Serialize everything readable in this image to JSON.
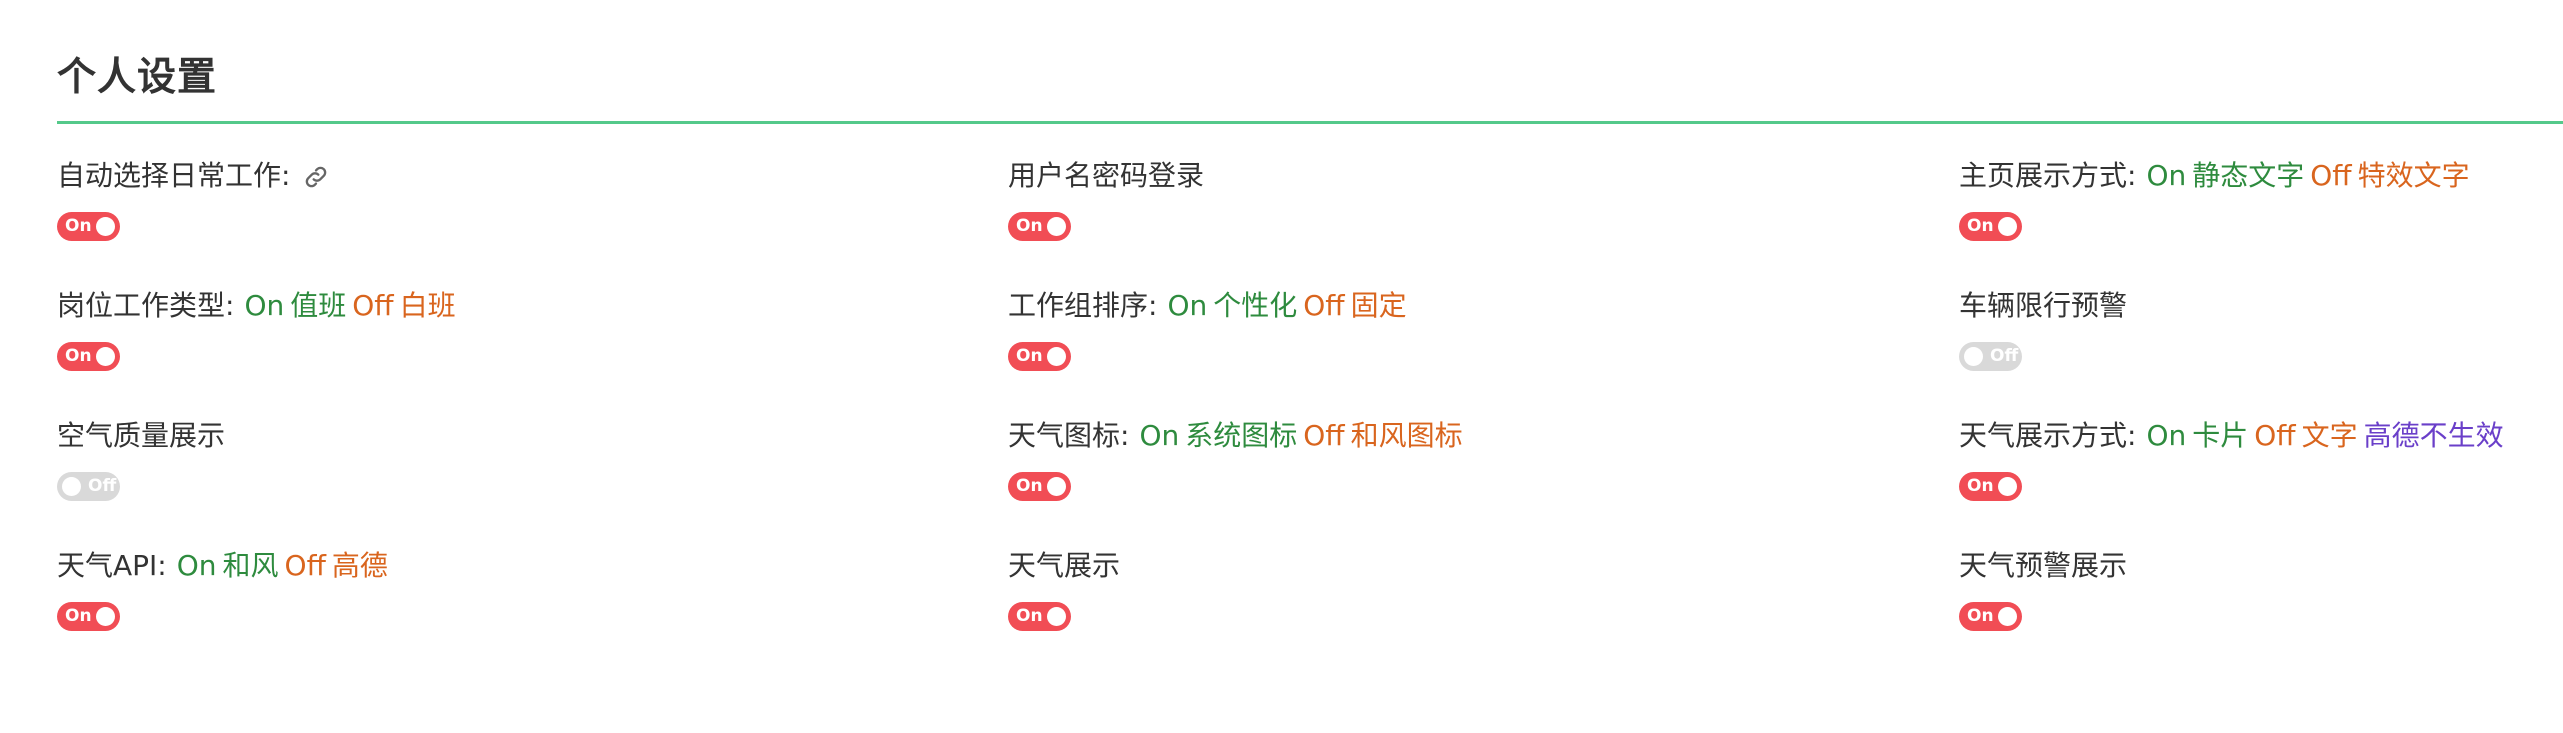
{
  "page_title": "个人设置",
  "colors": {
    "accent_line": "#54c98a",
    "switch_on": "#f14d55",
    "switch_off": "#d9d9d9",
    "on_option": "#2e8b3e",
    "off_option": "#d9651e",
    "extra_option": "#6a3fc9"
  },
  "settings": [
    {
      "name": "自动选择日常工作:",
      "icon": "link-icon",
      "state": "On"
    },
    {
      "name": "用户名密码登录",
      "state": "On"
    },
    {
      "name": "主页展示方式:",
      "on_key": "On",
      "on_label": "静态文字",
      "off_key": "Off",
      "off_label": "特效文字",
      "state": "On"
    },
    {
      "name": "岗位工作类型:",
      "on_key": "On",
      "on_label": "值班",
      "off_key": "Off",
      "off_label": "白班",
      "state": "On"
    },
    {
      "name": "工作组排序:",
      "on_key": "On",
      "on_label": "个性化",
      "off_key": "Off",
      "off_label": "固定",
      "state": "On"
    },
    {
      "name": "车辆限行预警",
      "state": "Off"
    },
    {
      "name": "空气质量展示",
      "state": "Off"
    },
    {
      "name": "天气图标:",
      "on_key": "On",
      "on_label": "系统图标",
      "off_key": "Off",
      "off_label": "和风图标",
      "state": "On"
    },
    {
      "name": "天气展示方式:",
      "on_key": "On",
      "on_label": "卡片",
      "off_key": "Off",
      "off_label": "文字",
      "extra": "高德不生效",
      "state": "On"
    },
    {
      "name": "天气API:",
      "on_key": "On",
      "on_label": "和风",
      "off_key": "Off",
      "off_label": "高德",
      "state": "On"
    },
    {
      "name": "天气展示",
      "state": "On"
    },
    {
      "name": "天气预警展示",
      "state": "On"
    }
  ]
}
